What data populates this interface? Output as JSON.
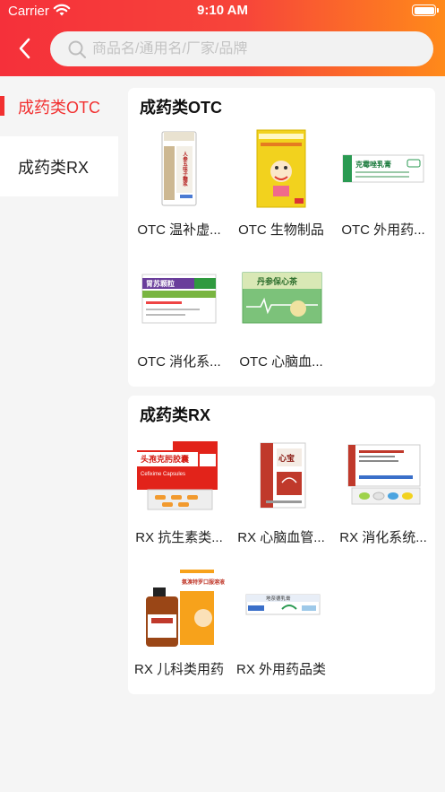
{
  "status_bar": {
    "carrier": "Carrier",
    "time": "9:10 AM"
  },
  "search": {
    "placeholder": "商品名/通用名/厂家/品牌"
  },
  "sidebar": {
    "items": [
      {
        "label": "成药类OTC",
        "active": true
      },
      {
        "label": "成药类RX",
        "active": false
      }
    ]
  },
  "sections": [
    {
      "title": "成药类OTC",
      "products": [
        {
          "name": "OTC 温补虚...",
          "image_text": "人参五味子糖浆"
        },
        {
          "name": "OTC 生物制品",
          "image_text": ""
        },
        {
          "name": "OTC 外用药...",
          "image_text": "克霉唑乳膏"
        },
        {
          "name": "OTC 消化系...",
          "image_text": "胃苏颗粒"
        },
        {
          "name": "OTC 心脑血...",
          "image_text": "丹参保心茶"
        }
      ]
    },
    {
      "title": "成药类RX",
      "products": [
        {
          "name": "RX 抗生素类...",
          "image_text": "头孢克肟胶囊",
          "image_subtext": "Cefixime Capsules"
        },
        {
          "name": "RX 心脑血管...",
          "image_text": "心宝"
        },
        {
          "name": "RX 消化系统...",
          "image_text": ""
        },
        {
          "name": "RX 儿科类用药",
          "image_text": "氨溴特罗口服溶液"
        },
        {
          "name": "RX 外用药品类",
          "image_text": "地奈德乳膏"
        }
      ]
    }
  ],
  "colors": {
    "accent": "#f23030",
    "header_start": "#f5303a",
    "header_end": "#ff8a1a"
  }
}
